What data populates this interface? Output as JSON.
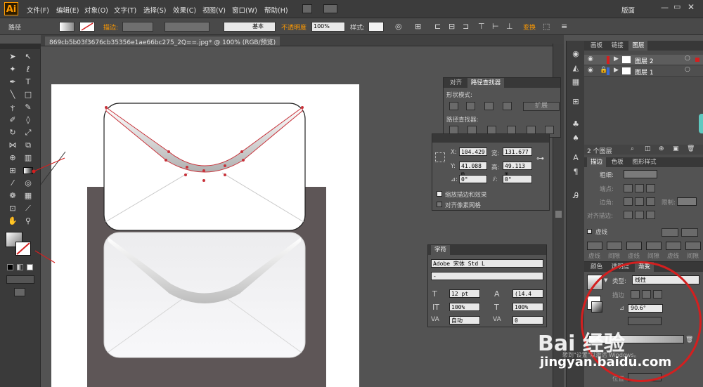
{
  "app": {
    "logo": "Ai",
    "workspace": "版面"
  },
  "menu": [
    "文件(F)",
    "编辑(E)",
    "对象(O)",
    "文字(T)",
    "选择(S)",
    "效果(C)",
    "视图(V)",
    "窗口(W)",
    "帮助(H)"
  ],
  "control": {
    "path_label": "路径",
    "stroke_label": "描边:",
    "brush_label": "基本",
    "opacity_label": "不透明度",
    "opacity_value": "100%",
    "style_label": "样式:",
    "transform_label": "变换"
  },
  "document": {
    "tab": "869cb5b03f3676cb35356e1ae66bc275_2Q==.jpg* @ 100% (RGB/预览)"
  },
  "pathfinder": {
    "tabs": [
      "对齐",
      "路径查找器"
    ],
    "shape_modes": "形状模式:",
    "expand": "扩展",
    "pathfinders": "路径查找器:"
  },
  "transform": {
    "x_label": "X:",
    "x": "104.429",
    "w_label": "宽:",
    "w": "131.677",
    "y_label": "Y:",
    "y": "41.088 m",
    "h_label": "高:",
    "h": "49.113 m",
    "angle1": "0°",
    "angle2": "0°",
    "scale_strokes": "缩放描边和效果",
    "align_pixel": "对齐像素网格"
  },
  "character": {
    "title": "字符",
    "font": "Adobe 宋体 Std L",
    "style": "-",
    "size": "12 pt",
    "leading": "(14.4",
    "vscale": "100%",
    "hscale": "100%",
    "tracking": "自动",
    "kerning": "0"
  },
  "layers": {
    "tabs": [
      "画板",
      "链接",
      "图层"
    ],
    "items": [
      "图层 2",
      "图层 1"
    ],
    "count": "2 个图层"
  },
  "stroke": {
    "tabs": [
      "描边",
      "色板",
      "图形样式"
    ],
    "weight_label": "粗细:",
    "cap_label": "端点:",
    "corner_label": "边角:",
    "limit_label": "限制:",
    "align_label": "对齐描边:",
    "dash_label": "虚线",
    "dash_cols": [
      "虚线",
      "间隙",
      "虚线",
      "间隙",
      "虚线",
      "间隙"
    ]
  },
  "gradient": {
    "tabs": [
      "颜色",
      "透明度",
      "渐变"
    ],
    "type_label": "类型:",
    "type": "线性",
    "stroke_label": "描边",
    "angle": "90.6°",
    "position_label": "位置"
  },
  "watermark": {
    "text": "Bai 经验",
    "url": "jingyan.baidu.com",
    "activate": "转到\"设置\"以激活 Windows。"
  },
  "colors": {
    "accent": "#ff9a00",
    "highlight": "#d41f1f",
    "path": "#c8323a"
  }
}
